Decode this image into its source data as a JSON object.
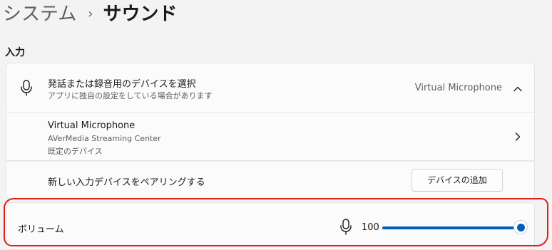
{
  "breadcrumb": {
    "parent": "システム",
    "separator": "›",
    "current": "サウンド"
  },
  "input_section": {
    "title": "入力",
    "device_select": {
      "title": "発話または録音用のデバイスを選択",
      "subtitle": "アプリに独自の設定をしている場合があります",
      "selected_value": "Virtual Microphone",
      "icon": "microphone-icon",
      "expand_icon": "chevron-up-icon"
    },
    "device_item": {
      "name": "Virtual Microphone",
      "source": "AVerMedia Streaming Center",
      "status": "既定のデバイス",
      "icon": "chevron-right-icon"
    },
    "pair": {
      "label": "新しい入力デバイスをペアリングする",
      "button_label": "デバイスの追加"
    },
    "volume": {
      "label": "ボリューム",
      "value_text": "100",
      "level_percent": 100,
      "icon": "microphone-icon"
    }
  },
  "colors": {
    "accent": "#005fb8",
    "highlight": "#e0201b",
    "background": "#f3f3f3",
    "card": "#fbfbfb"
  }
}
